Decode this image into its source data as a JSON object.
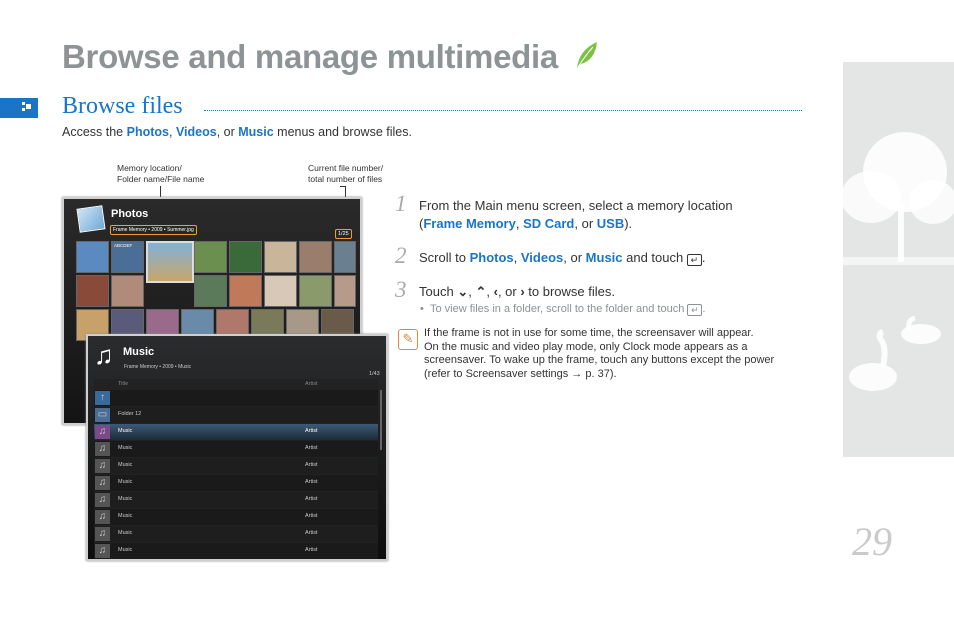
{
  "page": {
    "title": "Browse and manage multimedia",
    "page_number": "29"
  },
  "section": {
    "title": "Browse files",
    "intro": {
      "prefix": "Access the ",
      "photos": "Photos",
      "sep1": ", ",
      "videos": "Videos",
      "sep2": ", or ",
      "music": "Music",
      "suffix": " menus and browse files."
    }
  },
  "captions": {
    "left_line1": "Memory location/",
    "left_line2": "Folder name/File name",
    "right_line1": "Current file number/",
    "right_line2": "total number of files"
  },
  "photos_screen": {
    "title": "Photos",
    "path": "Frame Memory • 2009 • Summer.jpg",
    "count": "1/25",
    "folder_label": "ABCDEF"
  },
  "music_screen": {
    "title": "Music",
    "path": "Frame Memory • 2009 • Music",
    "count": "1/43",
    "col_title": "Title",
    "col_artist": "Artist",
    "rows": [
      {
        "title": "",
        "artist": ""
      },
      {
        "title": "Folder 12",
        "artist": ""
      },
      {
        "title": "Music",
        "artist": "Artist"
      },
      {
        "title": "Music",
        "artist": "Artist"
      },
      {
        "title": "Music",
        "artist": "Artist"
      },
      {
        "title": "Music",
        "artist": "Artist"
      },
      {
        "title": "Music",
        "artist": "Artist"
      },
      {
        "title": "Music",
        "artist": "Artist"
      },
      {
        "title": "Music",
        "artist": "Artist"
      },
      {
        "title": "Music",
        "artist": "Artist"
      }
    ]
  },
  "steps": {
    "s1": {
      "num": "1",
      "line1": "From the Main menu screen, select a memory location",
      "open": "(",
      "frame_memory": "Frame Memory",
      "c1": ", ",
      "sd_card": "SD Card",
      "c2": ", or ",
      "usb": "USB",
      "close": ")."
    },
    "s2": {
      "num": "2",
      "prefix": "Scroll to ",
      "photos": "Photos",
      "c1": ", ",
      "videos": "Videos",
      "c2": ", or ",
      "music": "Music",
      "mid": " and touch ",
      "end": "."
    },
    "s3": {
      "num": "3",
      "prefix": "Touch ",
      "suffix": " to browse files.",
      "bullet": "To view files in a folder, scroll to the folder and touch"
    }
  },
  "note": {
    "line1": "If the frame is not in use for some time, the screensaver will appear.",
    "line2": "On the music and video play mode, only Clock mode appears as a",
    "line3": "screensaver. To wake up the frame, touch any buttons except the power",
    "line4": "(refer to Screensaver settings → p. 37)."
  },
  "colors": {
    "accent": "#1a75c8",
    "title_gray": "#8e9396",
    "highlight": "#f0a030",
    "note": "#e8863a"
  },
  "icons": [
    "leaf-icon",
    "section-marker-icon",
    "enter-icon",
    "chevron-down-icon",
    "chevron-up-icon",
    "chevron-left-icon",
    "chevron-right-icon",
    "note-icon",
    "music-note-icon"
  ]
}
